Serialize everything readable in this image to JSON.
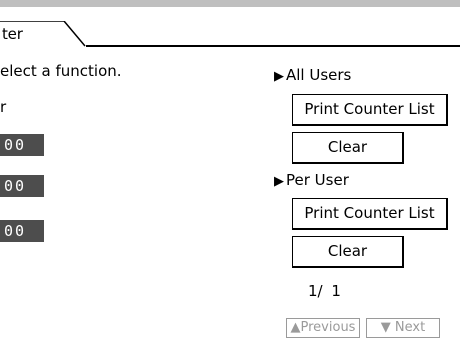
{
  "tab": {
    "label": "ter"
  },
  "instruction": "elect a function.",
  "left_label": "r",
  "counters": [
    "00",
    "00",
    "00"
  ],
  "all_users": {
    "heading": "All Users",
    "print_label": "Print Counter List",
    "clear_label": "Clear"
  },
  "per_user": {
    "heading": "Per User",
    "print_label": "Print Counter List",
    "clear_label": "Clear"
  },
  "page_indicator": "1/ 1",
  "nav": {
    "previous_label": "Previous",
    "next_label": "Next"
  },
  "icons": {
    "heading_marker": "play-triangle-icon",
    "previous": "up-triangle-icon",
    "next": "down-triangle-icon"
  }
}
